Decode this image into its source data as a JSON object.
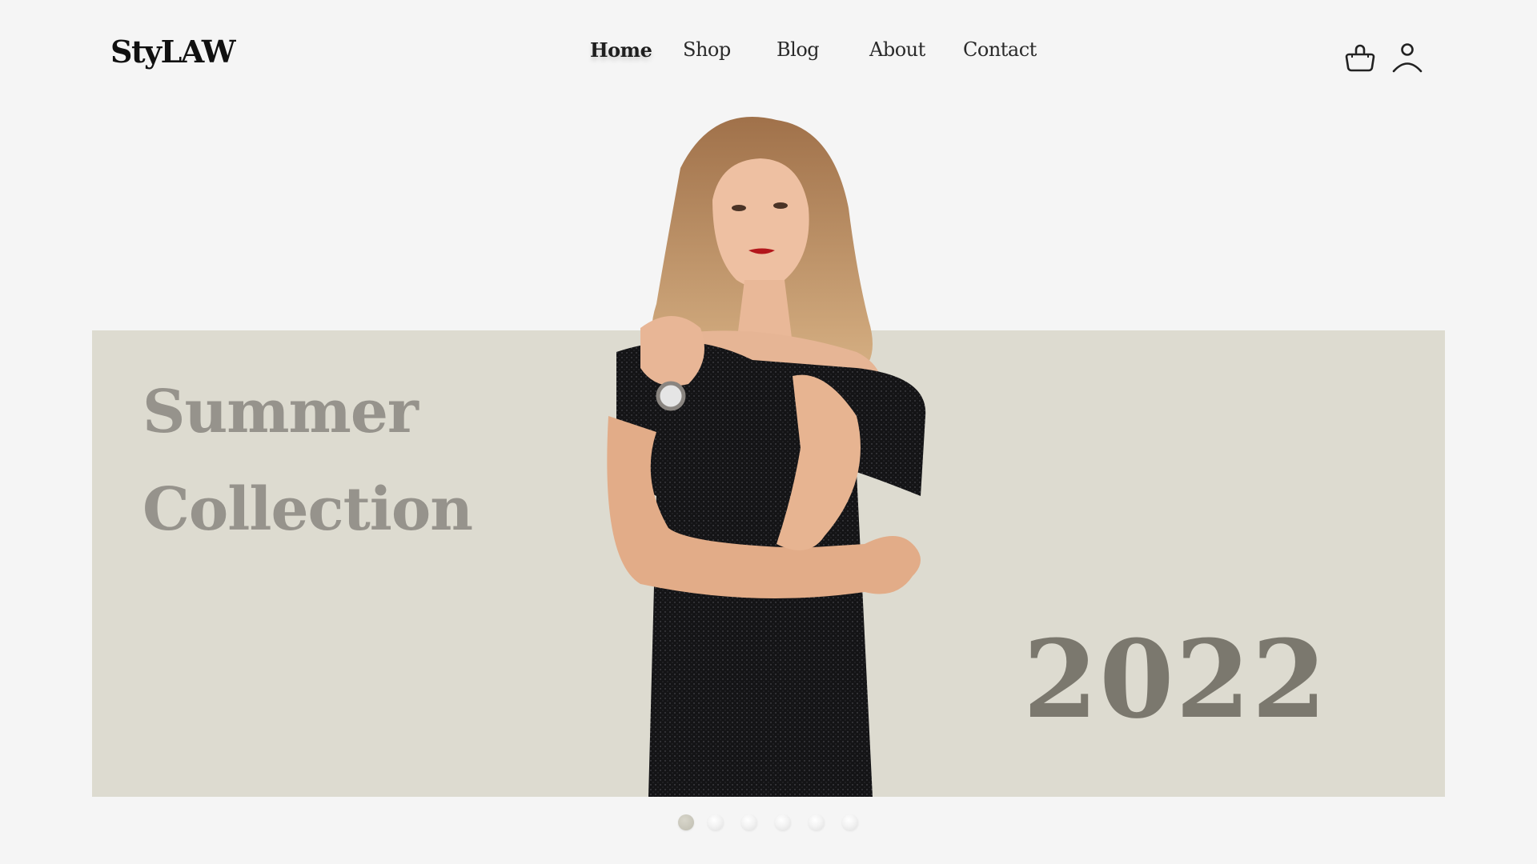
{
  "brand": {
    "logo": "StyLAW"
  },
  "nav": {
    "items": [
      {
        "label": "Home",
        "active": true
      },
      {
        "label": "Shop",
        "active": false
      },
      {
        "label": "Blog",
        "active": false
      },
      {
        "label": "About",
        "active": false
      },
      {
        "label": "Contact",
        "active": false
      }
    ]
  },
  "header_icons": {
    "cart": "shopping-bag-icon",
    "account": "user-icon"
  },
  "hero": {
    "line1": "Summer",
    "line2": "Collection",
    "year": "2022",
    "image_alt": "Model in black sparkly off-shoulder dress with wristwatch",
    "colors": {
      "banner_bg": "#dddbd0",
      "headline": "#96938c",
      "year": "#7b786e"
    }
  },
  "carousel": {
    "total_slides": 6,
    "active_index": 0
  }
}
